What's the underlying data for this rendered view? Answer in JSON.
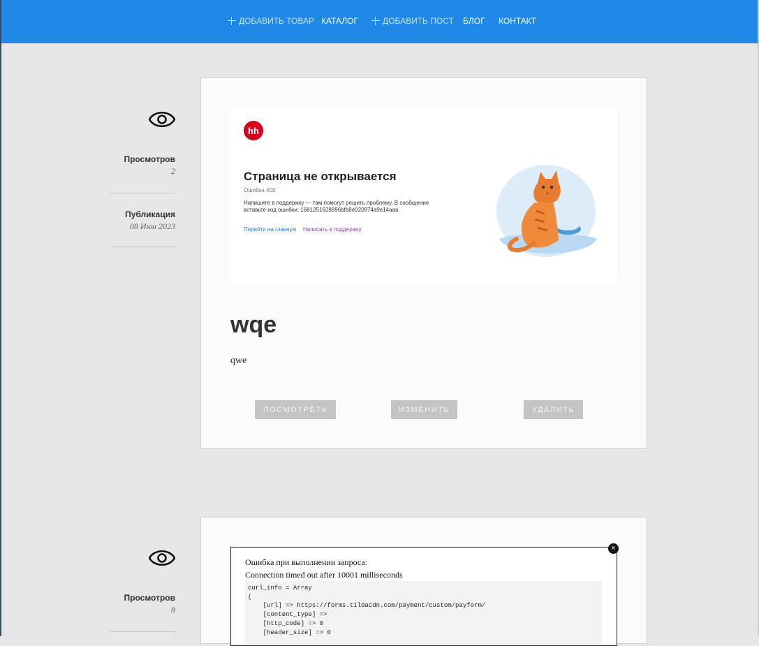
{
  "nav": {
    "items": [
      {
        "label": "Добавить товар",
        "plus": true
      },
      {
        "label": "Каталог",
        "plus": false
      },
      {
        "label": "Добавить пост",
        "plus": true
      },
      {
        "label": "Блог",
        "plus": false
      },
      {
        "label": "Контакт",
        "plus": false
      }
    ]
  },
  "posts": [
    {
      "views_label": "Просмотров",
      "views_value": "2",
      "published_label": "Публикация",
      "published_value": "08 Июн 2023",
      "image": {
        "logo_text": "hh",
        "title": "Страница не открывается",
        "code": "Ошибка 400",
        "text": "Напишите в поддержку — там помогут решить проблему. В сообщение вставьте код ошибки: 1681251628896bfb8e020974a9e14aaa",
        "link_home": "Перейти на главную",
        "link_support": "Написать в поддержку"
      },
      "title": "wqe",
      "body": "qwe",
      "buttons": {
        "view": "Посмотреть",
        "edit": "Изменить",
        "delete": "Удалить"
      }
    },
    {
      "views_label": "Просмотров",
      "views_value": "8",
      "image": {
        "line1": "Ошибка при выполнении запроса:",
        "line2": "Connection timed out after 10001 milliseconds",
        "code_lines": [
          "curl_info = Array",
          "(",
          "    [url] => https://forms.tildacdn.com/payment/custom/payform/",
          "    [content_type] =>",
          "    [http_code] => 0",
          "    [header_size] => 0"
        ]
      }
    }
  ],
  "colors": {
    "nav": "#2089e8",
    "button": "#c4c4c4",
    "hh_red": "#d6001c",
    "background": "#e6e6e6"
  }
}
